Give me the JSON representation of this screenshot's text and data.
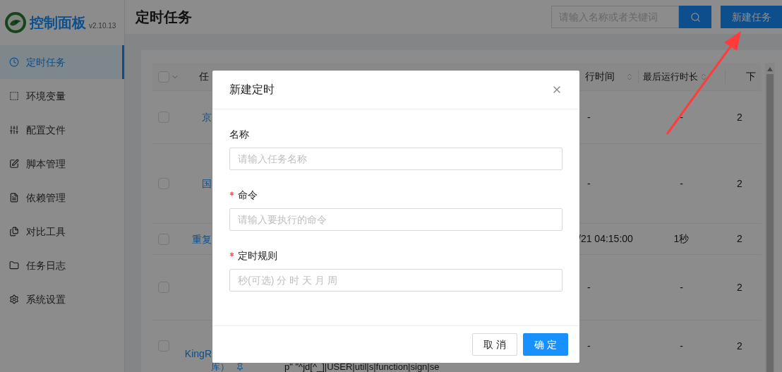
{
  "sidebar": {
    "logo_title": "控制面板",
    "version": "v2.10.13",
    "items": [
      {
        "label": "定时任务",
        "selected": true
      },
      {
        "label": "环境变量",
        "selected": false
      },
      {
        "label": "配置文件",
        "selected": false
      },
      {
        "label": "脚本管理",
        "selected": false
      },
      {
        "label": "依赖管理",
        "selected": false
      },
      {
        "label": "对比工具",
        "selected": false
      },
      {
        "label": "任务日志",
        "selected": false
      },
      {
        "label": "系统设置",
        "selected": false
      }
    ]
  },
  "header": {
    "title": "定时任务",
    "search": {
      "placeholder": "请输入名称或者关键词"
    },
    "new_button": "新建任务"
  },
  "table": {
    "select_all_checked": false,
    "columns": [
      "任",
      "行时间",
      "最后运行时长",
      "下"
    ],
    "rows": [
      {
        "checked": false,
        "name_lines": [
          "京"
        ],
        "last_run_time": "-",
        "last_run_duration": "-",
        "column_5": "2"
      },
      {
        "checked": false,
        "name_lines": [
          "国"
        ],
        "last_run_time": "-",
        "last_run_duration": "-",
        "column_5": "2"
      },
      {
        "checked": false,
        "name_lines": [
          "重复"
        ],
        "last_run_time": "/21 04:15:00",
        "last_run_duration": "1秒",
        "column_5": "2"
      },
      {
        "checked": false,
        "name_lines": [],
        "last_run_time": "-",
        "last_run_duration": "-",
        "column_5": "2"
      },
      {
        "checked": false,
        "name_lines": [
          "KingR",
          "库）"
        ],
        "pinned": true,
        "command": "p\" \"^jd[^_]|USER|util|s|function|sign|se",
        "last_run_time": "-",
        "last_run_duration": "-",
        "column_5": "2"
      }
    ]
  },
  "dialog": {
    "title": "新建定时",
    "fields": [
      {
        "label": "名称",
        "required": false,
        "placeholder": "请输入任务名称"
      },
      {
        "label": "命令",
        "required": true,
        "placeholder": "请输入要执行的命令"
      },
      {
        "label": "定时规则",
        "required": true,
        "placeholder": "秒(可选) 分 时 天 月 周"
      }
    ],
    "cancel": "取 消",
    "ok": "确 定"
  }
}
